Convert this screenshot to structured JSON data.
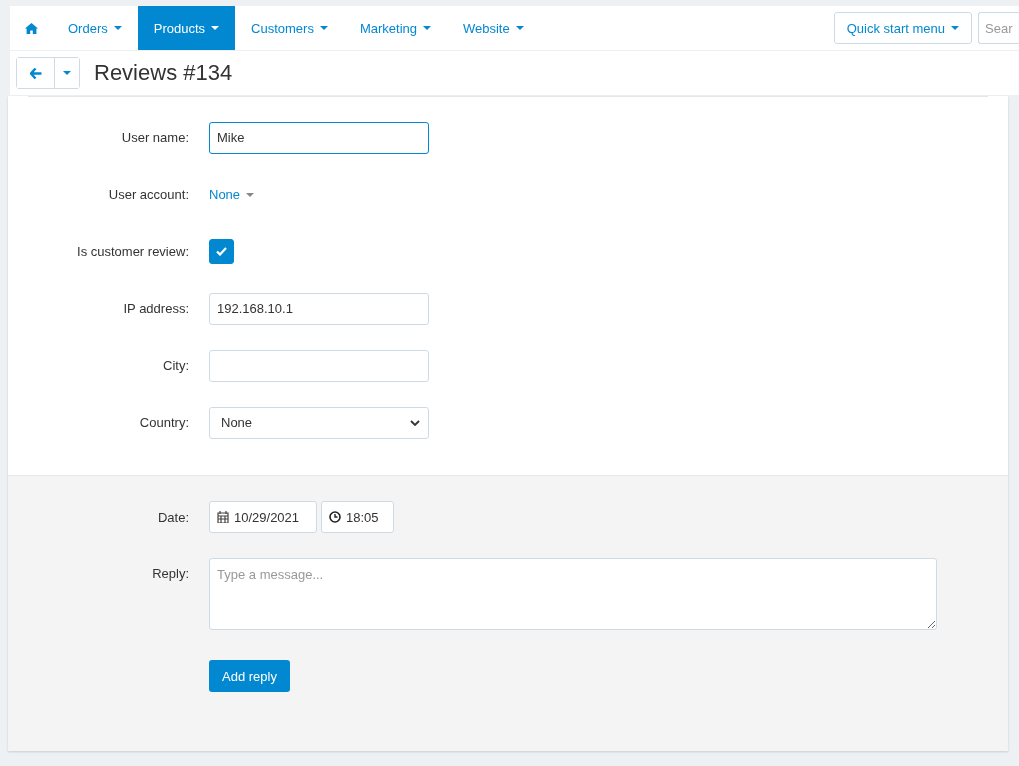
{
  "nav": {
    "items": [
      {
        "kind": "home",
        "selected": false
      },
      {
        "kind": "menu",
        "label": "Orders",
        "selected": false
      },
      {
        "kind": "menu",
        "label": "Products",
        "selected": true
      },
      {
        "kind": "menu",
        "label": "Customers",
        "selected": false
      },
      {
        "kind": "menu",
        "label": "Marketing",
        "selected": false
      },
      {
        "kind": "menu",
        "label": "Website",
        "selected": false
      }
    ],
    "quick_start": "Quick start menu",
    "search": {
      "placeholder": "Sear"
    }
  },
  "header": {
    "title": "Reviews #134"
  },
  "form": {
    "fields": [
      {
        "kind": "text",
        "label": "User name:",
        "value": "Mike",
        "focused": true
      },
      {
        "kind": "picker",
        "label": "User account:",
        "value": "None"
      },
      {
        "kind": "checkbox",
        "label": "Is customer review:",
        "checked": true
      },
      {
        "kind": "text",
        "label": "IP address:",
        "value": "192.168.10.1",
        "focused": false
      },
      {
        "kind": "text",
        "label": "City:",
        "focused": false
      },
      {
        "kind": "select",
        "label": "Country:",
        "value": "None"
      }
    ]
  },
  "reply": {
    "date_label": "Date:",
    "date": "10/29/2021",
    "time": "18:05",
    "reply_label": "Reply:",
    "placeholder": "Type a message...",
    "button": "Add reply"
  }
}
